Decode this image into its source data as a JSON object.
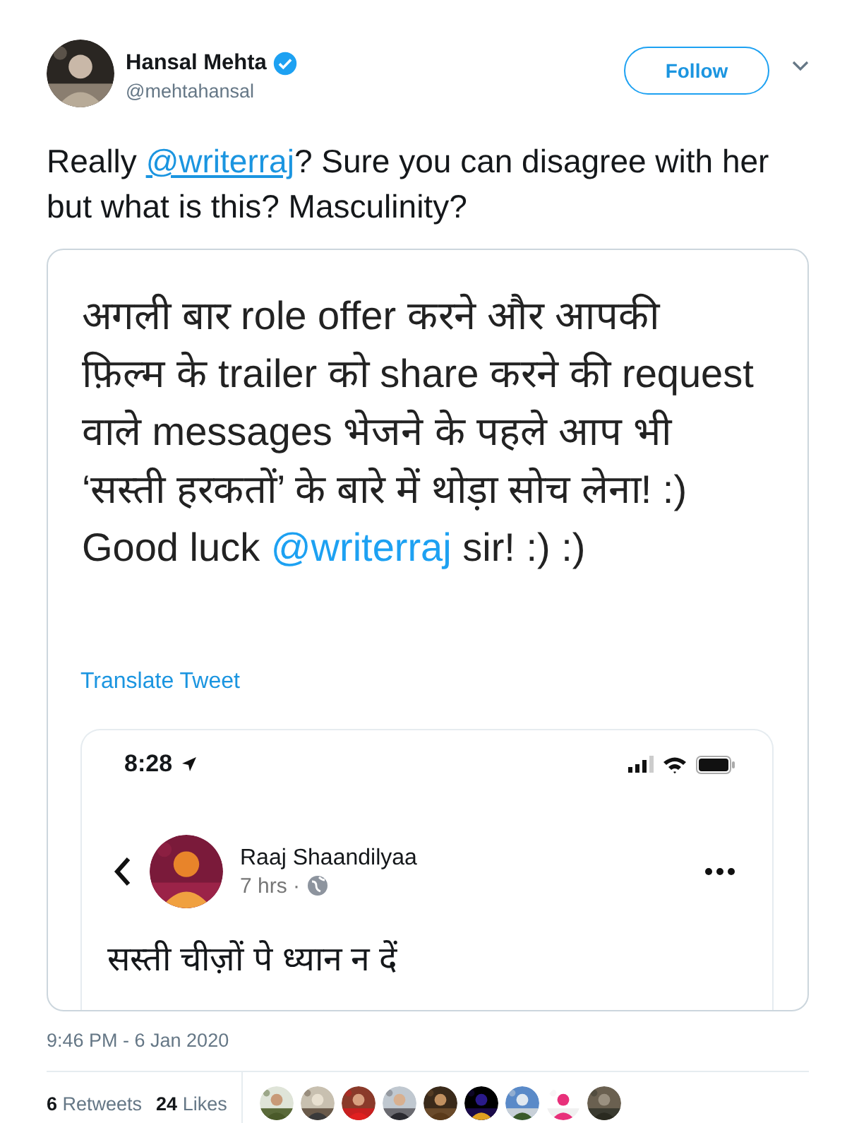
{
  "author": {
    "name": "Hansal Mehta",
    "handle": "@mehtahansal",
    "verified": true
  },
  "follow_button": "Follow",
  "tweet_text": {
    "before": "Really ",
    "mention": "@writerraj",
    "after": "? Sure you can disagree with her but what is this? Masculinity?"
  },
  "attachment": {
    "lines": [
      [
        {
          "kind": "plain",
          "text": "अगली बार role offer करने और आपकी"
        }
      ],
      [
        {
          "kind": "plain",
          "text": "फ़िल्म के trailer को share करने की request"
        }
      ],
      [
        {
          "kind": "plain",
          "text": "वाले messages भेजने के पहले आप भी"
        }
      ],
      [
        {
          "kind": "plain",
          "text": "‘सस्ती हरकतों’ के बारे में थोड़ा सोच लेना! :)"
        }
      ],
      [
        {
          "kind": "plain",
          "text": "Good luck "
        },
        {
          "kind": "mention",
          "text": "@writerraj"
        },
        {
          "kind": "plain",
          "text": " sir! :) :)"
        }
      ]
    ],
    "translate_link": "Translate Tweet",
    "phone": {
      "status_time": "8:28",
      "post_author": "Raaj Shaandilyaa",
      "post_time": "7 hrs ·",
      "post_text": "सस्ती चीज़ों पे ध्यान न दें"
    }
  },
  "timestamp": "9:46 PM - 6 Jan 2020",
  "stats": [
    {
      "count": "6",
      "label": "Retweets"
    },
    {
      "count": "24",
      "label": "Likes"
    }
  ]
}
